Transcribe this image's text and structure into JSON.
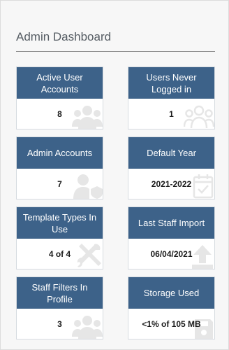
{
  "dashboard": {
    "title": "Admin Dashboard",
    "cards": [
      {
        "label": "Active User Accounts",
        "value": "8",
        "icon": "users-group-icon"
      },
      {
        "label": "Users Never Logged in",
        "value": "1",
        "icon": "users-outline-icon"
      },
      {
        "label": "Admin Accounts",
        "value": "7",
        "icon": "user-shield-icon"
      },
      {
        "label": "Default Year",
        "value": "2021-2022",
        "icon": "calendar-check-icon"
      },
      {
        "label": "Template Types In Use",
        "value": "4 of 4",
        "icon": "tools-icon"
      },
      {
        "label": "Last Staff Import",
        "value": "06/04/2021",
        "icon": "upload-icon"
      },
      {
        "label": "Staff Filters In Profile",
        "value": "3",
        "icon": "users-group-icon"
      },
      {
        "label": "Storage Used",
        "value": "<1% of 105 MB",
        "icon": "storage-icon"
      }
    ]
  },
  "colors": {
    "card_header": "#3d6289",
    "icon_watermark": "#e6e6e6"
  }
}
